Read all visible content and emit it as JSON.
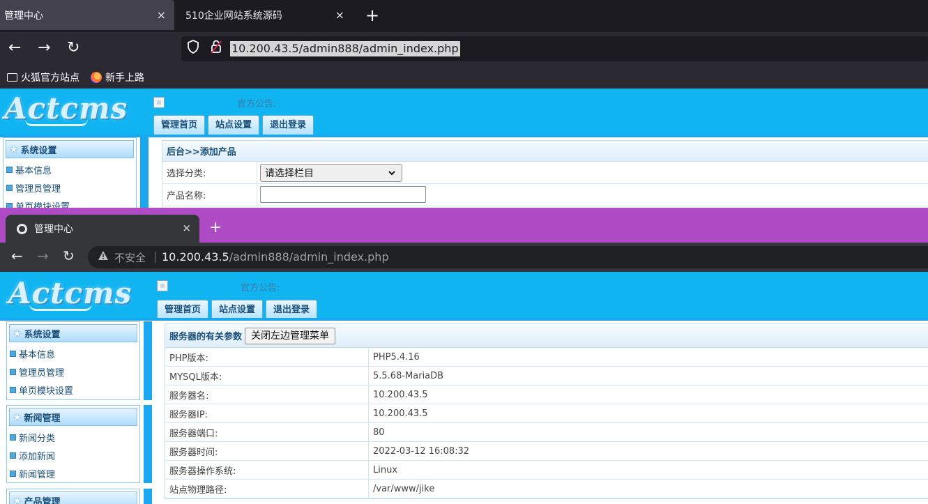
{
  "firefox": {
    "tabs": [
      {
        "title": "管理中心",
        "close": "×"
      },
      {
        "title": "510企业网站系统源码",
        "close": "×"
      }
    ],
    "new_tab": "+",
    "nav": {
      "back": "←",
      "forward": "→",
      "reload": "↻"
    },
    "url": "10.200.43.5/admin888/admin_index.php",
    "bookmarks": [
      "火狐官方站点",
      "新手上路"
    ]
  },
  "chrome": {
    "tab_title": "管理中心",
    "tab_close": "×",
    "new_tab": "+",
    "nav": {
      "back": "←",
      "forward": "→",
      "reload": "↻"
    },
    "insecure_label": "不安全",
    "separator": "|",
    "url_host": "10.200.43.5",
    "url_path": "/admin888/admin_index.php"
  },
  "cms": {
    "logo": "Actcms",
    "notice": "官方公告:",
    "top_nav": [
      "管理首页",
      "站点设置",
      "退出登录"
    ],
    "sidebar": [
      {
        "title": "系统设置",
        "items": [
          "基本信息",
          "管理员管理",
          "单页模块设置"
        ]
      },
      {
        "title": "新闻管理",
        "items": [
          "新闻分类",
          "添加新闻",
          "新闻管理"
        ]
      },
      {
        "title": "产品管理",
        "items": []
      }
    ]
  },
  "add_product": {
    "breadcrumb": "后台>>添加产品",
    "category_label": "选择分类:",
    "category_selected": "请选择栏目",
    "name_label": "产品名称:"
  },
  "server_info": {
    "title": "服务器的有关参数",
    "toggle_button": "关闭左边管理菜单",
    "rows": [
      {
        "k": "PHP版本:",
        "v": "PHP5.4.16"
      },
      {
        "k": "MYSQL版本:",
        "v": "5.5.68-MariaDB"
      },
      {
        "k": "服务器名:",
        "v": "10.200.43.5"
      },
      {
        "k": "服务器IP:",
        "v": "10.200.43.5"
      },
      {
        "k": "服务器端口:",
        "v": "80"
      },
      {
        "k": "服务器时间:",
        "v": "2022-03-12 16:08:32"
      },
      {
        "k": "服务器操作系统:",
        "v": "Linux"
      },
      {
        "k": "站点物理路径:",
        "v": "/var/www/jike"
      }
    ]
  },
  "colors": {
    "header_blue": "#10b4f1",
    "chrome_tabbar": "#b04bc6",
    "firefox_dark": "#1c1b22"
  }
}
